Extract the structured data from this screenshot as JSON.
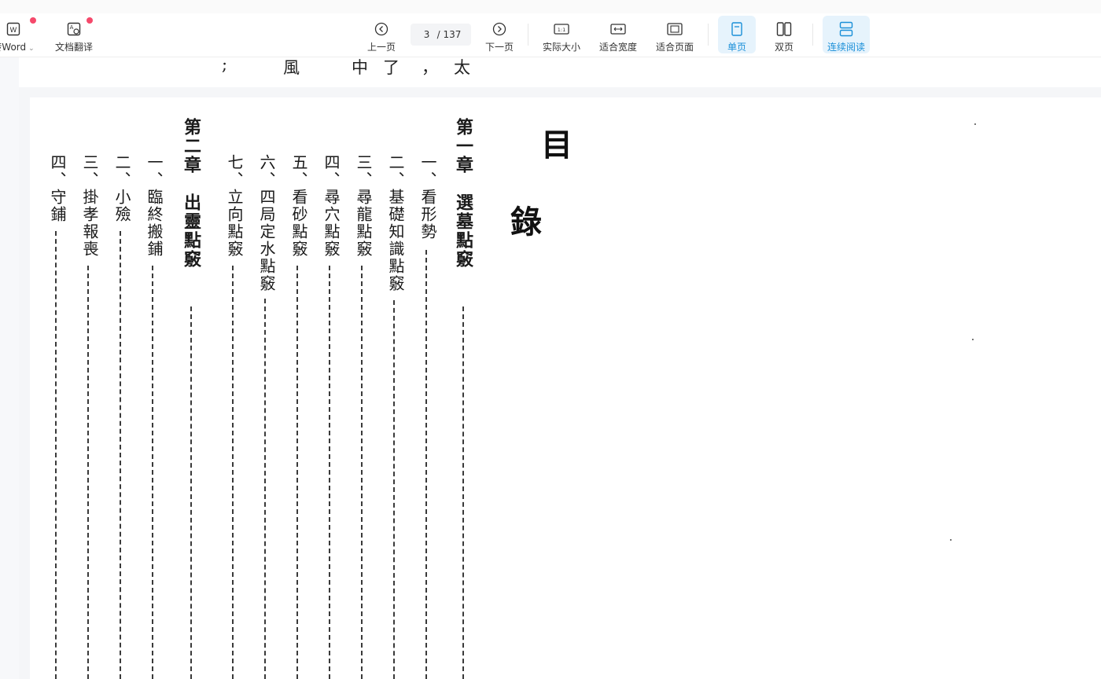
{
  "toolbar": {
    "to_word_label": "转Word",
    "translate_label": "文档翻译",
    "prev_label": "上一页",
    "current_page": "3",
    "total_pages": "/ 137",
    "next_label": "下一页",
    "actual_size_label": "实际大小",
    "fit_width_label": "适合宽度",
    "fit_page_label": "适合页面",
    "single_page_label": "单页",
    "double_page_label": "双页",
    "continuous_label": "连续阅读"
  },
  "previous_page": {
    "chars": [
      ";",
      "風",
      "中",
      "了",
      "，",
      "太"
    ]
  },
  "toc": {
    "title_top": "目",
    "title_bottom": "錄",
    "chapter1": "第一章　選墓點竅",
    "chapter1_items": [
      "一、看形勢",
      "二、基礎知識點竅",
      "三、尋龍點竅",
      "四、尋穴點竅",
      "五、看砂點竅",
      "六、四局定水點竅",
      "七、立向點竅"
    ],
    "chapter2": "第二章　出靈點竅",
    "chapter2_items": [
      "一、臨終搬鋪",
      "二、小殮",
      "三、掛孝報喪",
      "四、守鋪"
    ]
  },
  "colors": {
    "accent": "#1a8fd8",
    "active_bg": "#e6f3fc",
    "badge": "#f5496b"
  }
}
